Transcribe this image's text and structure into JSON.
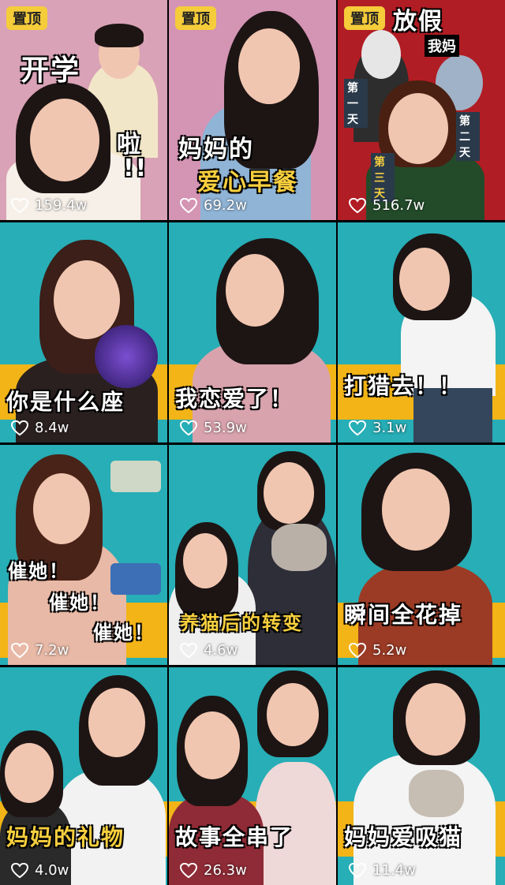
{
  "pin_label": "置顶",
  "tiles": [
    {
      "caption": "开学",
      "caption2": "啦",
      "caption3": "!!",
      "likes": "159.4w",
      "pinned": true
    },
    {
      "caption": "妈妈的",
      "caption2": "爱心早餐",
      "likes": "69.2w",
      "pinned": true
    },
    {
      "caption": "放假",
      "caption2": "我妈",
      "caption3": "第一天",
      "caption4": "第二天",
      "caption5": "第三天",
      "likes": "516.7w",
      "pinned": true
    },
    {
      "caption": "你是什么座",
      "likes": "8.4w"
    },
    {
      "caption": "我恋爱了！",
      "likes": "53.9w"
    },
    {
      "caption": "打猎去！！",
      "likes": "3.1w"
    },
    {
      "caption": "催她！",
      "caption2": "催她！",
      "caption3": "催她！",
      "likes": "7.2w"
    },
    {
      "caption": "养猫后的转变",
      "likes": "4.6w"
    },
    {
      "caption": "瞬间全花掉",
      "likes": "5.2w"
    },
    {
      "caption": "妈妈的礼物",
      "likes": "4.0w"
    },
    {
      "caption": "故事全串了",
      "likes": "26.3w"
    },
    {
      "caption": "妈妈爱吸猫",
      "likes": "11.4w"
    }
  ]
}
